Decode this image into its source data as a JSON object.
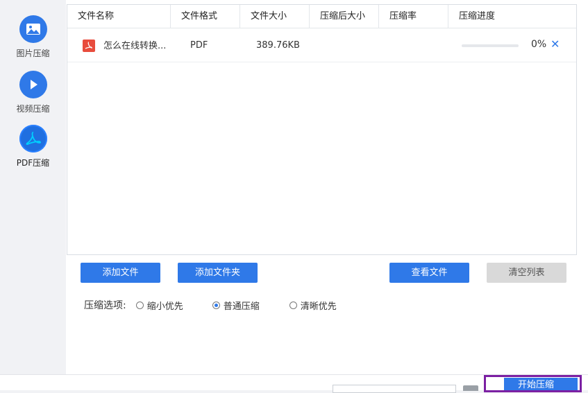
{
  "sidebar": {
    "items": [
      {
        "label": "图片压缩",
        "icon": "image-icon"
      },
      {
        "label": "视频压缩",
        "icon": "play-icon"
      },
      {
        "label": "PDF压缩",
        "icon": "pdf-icon",
        "active": true
      }
    ]
  },
  "table": {
    "columns": [
      "文件名称",
      "文件格式",
      "文件大小",
      "压缩后大小",
      "压缩率",
      "压缩进度"
    ],
    "rows": [
      {
        "name": "怎么在线转换...",
        "format": "PDF",
        "size": "389.76KB",
        "compressed_size": "",
        "ratio": "",
        "progress": "0%",
        "progress_value": 0
      }
    ]
  },
  "buttons": {
    "add_file": "添加文件",
    "add_folder": "添加文件夹",
    "view_files": "查看文件",
    "clear_list": "清空列表"
  },
  "options": {
    "label": "压缩选项:",
    "choices": [
      "缩小优先",
      "普通压缩",
      "清晰优先"
    ],
    "selected": "普通压缩"
  },
  "footer": {
    "start_label": "开始压缩"
  },
  "colors": {
    "accent": "#2f79e8",
    "highlight": "#7b1fa2",
    "pdf": "#e84c3d"
  }
}
